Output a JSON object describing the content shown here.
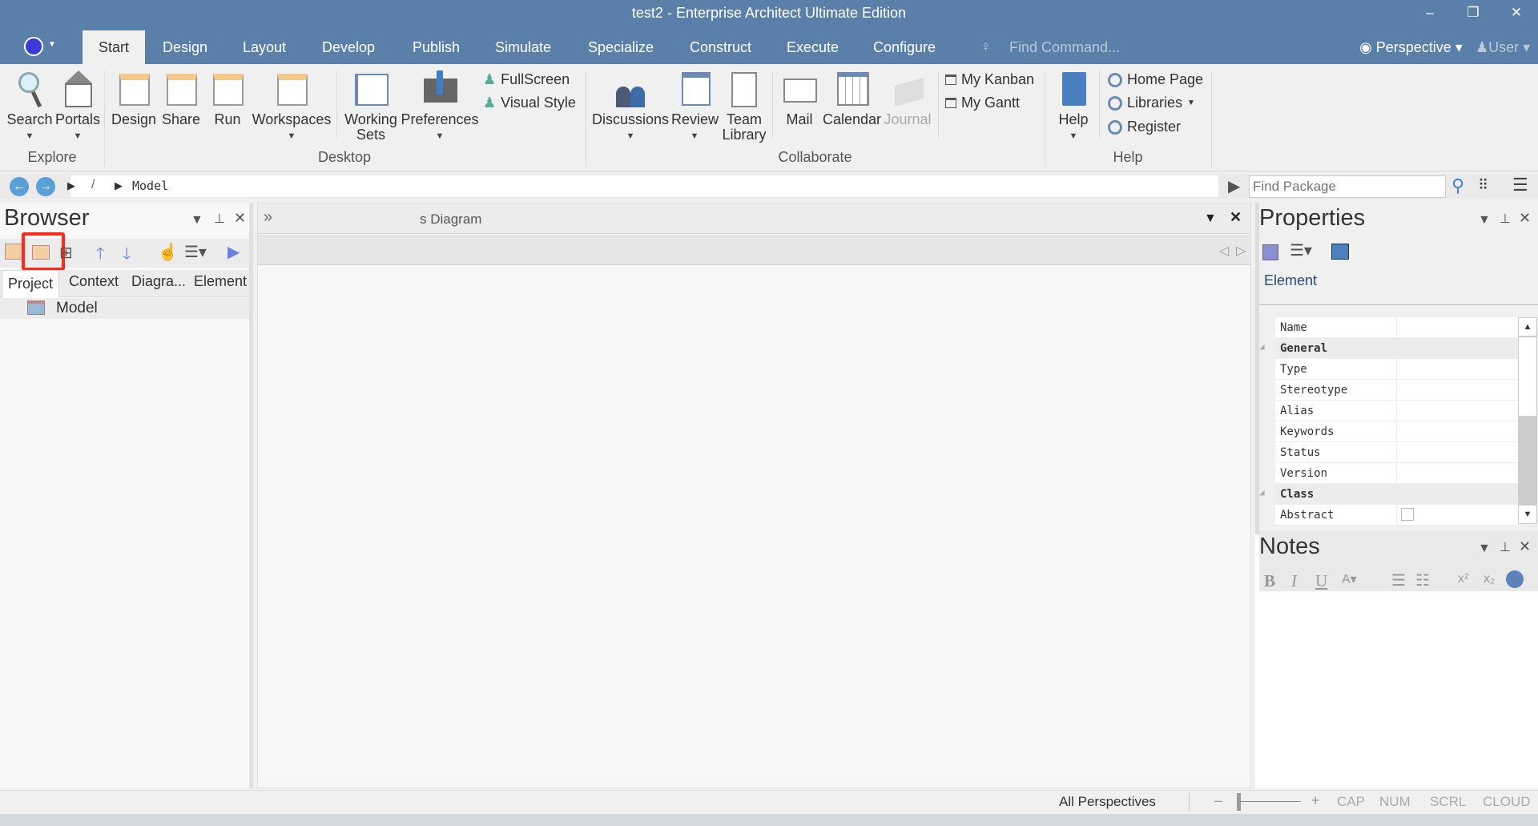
{
  "window": {
    "title": "test2 - Enterprise Architect Ultimate Edition"
  },
  "menu": {
    "tabs": [
      "Start",
      "Design",
      "Layout",
      "Develop",
      "Publish",
      "Simulate",
      "Specialize",
      "Construct",
      "Execute",
      "Configure"
    ],
    "find_command": "Find Command...",
    "perspective": "Perspective",
    "user": "User"
  },
  "ribbon": {
    "explore": {
      "label": "Explore",
      "search": "Search",
      "portals": "Portals"
    },
    "desktop": {
      "label": "Desktop",
      "design": "Design",
      "share": "Share",
      "run": "Run",
      "workspaces": "Workspaces",
      "working_sets_1": "Working",
      "working_sets_2": "Sets",
      "preferences": "Preferences",
      "fullscreen": "FullScreen",
      "visual_style": "Visual Style"
    },
    "collaborate": {
      "label": "Collaborate",
      "discussions": "Discussions",
      "review": "Review",
      "team_library_1": "Team",
      "team_library_2": "Library",
      "mail": "Mail",
      "calendar": "Calendar",
      "journal": "Journal",
      "my_kanban": "My Kanban",
      "my_gantt": "My Gantt"
    },
    "help": {
      "label": "Help",
      "help": "Help",
      "home_page": "Home Page",
      "libraries": "Libraries",
      "register": "Register"
    }
  },
  "breadcrumb": {
    "sep": "/",
    "item": "Model",
    "find_package_placeholder": "Find Package"
  },
  "browser": {
    "title": "Browser",
    "tabs": [
      "Project",
      "Context",
      "Diagra...",
      "Element"
    ],
    "tree": [
      "Model"
    ]
  },
  "diagram": {
    "tab_title": "s Diagram"
  },
  "properties": {
    "title": "Properties",
    "section": "Element",
    "rows": [
      {
        "label": "Name",
        "category": false
      },
      {
        "label": "General",
        "category": true
      },
      {
        "label": "Type",
        "category": false
      },
      {
        "label": "Stereotype",
        "category": false
      },
      {
        "label": "Alias",
        "category": false
      },
      {
        "label": "Keywords",
        "category": false
      },
      {
        "label": "Status",
        "category": false
      },
      {
        "label": "Version",
        "category": false
      },
      {
        "label": "Class",
        "category": true
      },
      {
        "label": "Abstract",
        "category": false
      }
    ]
  },
  "notes": {
    "title": "Notes",
    "tools": [
      "B",
      "I",
      "U"
    ]
  },
  "status": {
    "perspectives": "All Perspectives",
    "zoom_minus": "–",
    "zoom_plus": "+",
    "indicators": [
      "CAP",
      "NUM",
      "SCRL",
      "CLOUD"
    ]
  },
  "colors": {
    "titlebar": "#5a7fa8",
    "highlight": "#ff2a1a"
  }
}
